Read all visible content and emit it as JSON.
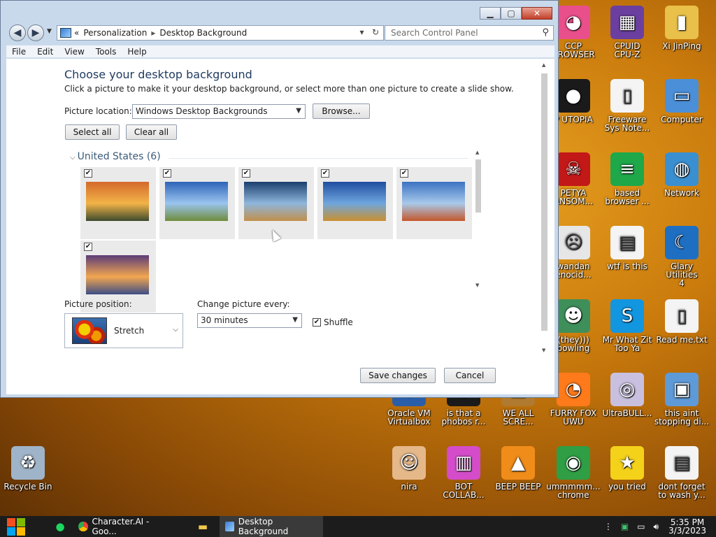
{
  "window": {
    "address": {
      "prefix": "«",
      "crumb1": "Personalization",
      "separator": "▸",
      "crumb2": "Desktop Background"
    },
    "search_placeholder": "Search Control Panel",
    "menu": [
      "File",
      "Edit",
      "View",
      "Tools",
      "Help"
    ]
  },
  "page": {
    "heading": "Choose your desktop background",
    "subtext": "Click a picture to make it your desktop background, or select more than one picture to create a slide show.",
    "picture_location_label": "Picture location:",
    "picture_location_value": "Windows Desktop Backgrounds",
    "browse_label": "Browse...",
    "select_all_label": "Select all",
    "clear_all_label": "Clear all",
    "group_title": "United States (6)",
    "group_chevron": "⌵",
    "check_mark": "✔",
    "thumbs": [
      {
        "checked": true,
        "colors": [
          "#d46a2c",
          "#f2b347",
          "#3d4b2e"
        ]
      },
      {
        "checked": true,
        "colors": [
          "#2e64b8",
          "#9ac4ef",
          "#6f8c3a"
        ]
      },
      {
        "checked": true,
        "colors": [
          "#1b3f6e",
          "#8fb6dc",
          "#c28f4b"
        ]
      },
      {
        "checked": true,
        "colors": [
          "#1f4da0",
          "#6fa6de",
          "#c9902e"
        ]
      },
      {
        "checked": true,
        "colors": [
          "#3b72c2",
          "#a8c9ea",
          "#c4572a"
        ]
      },
      {
        "checked": true,
        "colors": [
          "#5b3d78",
          "#f2a650",
          "#3c4d86"
        ]
      }
    ],
    "picture_position_label": "Picture position:",
    "picture_position_value": "Stretch",
    "change_every_label": "Change picture every:",
    "change_every_value": "30 minutes",
    "shuffle_label": "Shuffle",
    "shuffle_checked": true,
    "save_label": "Save changes",
    "cancel_label": "Cancel"
  },
  "desktop_icons": [
    {
      "label": "CCP\nBROWSER",
      "icon": "browser-icon",
      "color": "#e94f8a"
    },
    {
      "label": "CPUID\nCPU-Z",
      "icon": "cpuz-icon",
      "color": "#6b3fa0"
    },
    {
      "label": "Xi JinPing",
      "icon": "folder-user-icon",
      "color": "#e8c04a"
    },
    {
      "label": "P UTOPIA",
      "icon": "utopia-icon",
      "color": "#1a1a1a"
    },
    {
      "label": "Freeware\nSys Note...",
      "icon": "document-icon",
      "color": "#f4f4f4"
    },
    {
      "label": "Computer",
      "icon": "computer-icon",
      "color": "#4a8fd8"
    },
    {
      "label": "PETYA\nANSOM...",
      "icon": "skull-icon",
      "color": "#c21818"
    },
    {
      "label": "based\nbrowser ...",
      "icon": "chat-icon",
      "color": "#1ea84a"
    },
    {
      "label": "Network",
      "icon": "network-icon",
      "color": "#3a8fd0"
    },
    {
      "label": "wandan\nenocid...",
      "icon": "face-icon",
      "color": "#e6e6e6"
    },
    {
      "label": "wtf is this",
      "icon": "calendar-doc-icon",
      "color": "#f4f4f4"
    },
    {
      "label": "Glary Utilities\n4",
      "icon": "glary-icon",
      "color": "#1e6fc2"
    },
    {
      "label": "(they)))\nbowling",
      "icon": "santa-icon",
      "color": "#3f8f5a"
    },
    {
      "label": "Mr What Zit\nToo Ya",
      "icon": "skype-icon",
      "color": "#1296e0"
    },
    {
      "label": "Read me.txt",
      "icon": "text-file-icon",
      "color": "#f4f4f4"
    },
    {
      "label": "Oracle VM\nVirtualbox",
      "icon": "virtualbox-icon",
      "color": "#2a5ea8"
    },
    {
      "label": "is that a\nphobos r...",
      "icon": "phobos-icon",
      "color": "#1a1a1a"
    },
    {
      "label": "WE ALL\nSCRE...",
      "icon": "scream-icon",
      "color": "#b07a30"
    },
    {
      "label": "FURRY FOX\nUWU",
      "icon": "firefox-icon",
      "color": "#ff7a1a"
    },
    {
      "label": "UltraBULL...",
      "icon": "disc-icon",
      "color": "#c9c0e0"
    },
    {
      "label": "this aint\nstopping di...",
      "icon": "installer-icon",
      "color": "#5e9ad8"
    },
    {
      "label": "Recycle Bin",
      "icon": "recycle-bin-icon",
      "color": "#9fb4c8"
    },
    {
      "label": "nira",
      "icon": "hank-icon",
      "color": "#e5b88a"
    },
    {
      "label": "BOT\nCOLLAB...",
      "icon": "monitor-icon",
      "color": "#d44cc9"
    },
    {
      "label": "BEEP BEEP",
      "icon": "vlc-icon",
      "color": "#f08c1a"
    },
    {
      "label": "ummmmm...\nchrome",
      "icon": "chrome-icon",
      "color": "#2f9e44"
    },
    {
      "label": "you tried",
      "icon": "star-icon",
      "color": "#f4d21a"
    },
    {
      "label": "dont forget\nto wash y...",
      "icon": "calendar-doc-icon",
      "color": "#f4f4f4"
    }
  ],
  "taskbar": {
    "items": [
      {
        "label": "Character.AI - Goo...",
        "icon": "chrome-icon"
      },
      {
        "label": "Desktop Background",
        "icon": "control-panel-icon"
      }
    ],
    "time": "5:35 PM",
    "date": "3/3/2023"
  },
  "colors": {
    "accent": "#1e3a5f",
    "close_button": "#c2402a",
    "desktop_bg": "#c97a0c"
  }
}
